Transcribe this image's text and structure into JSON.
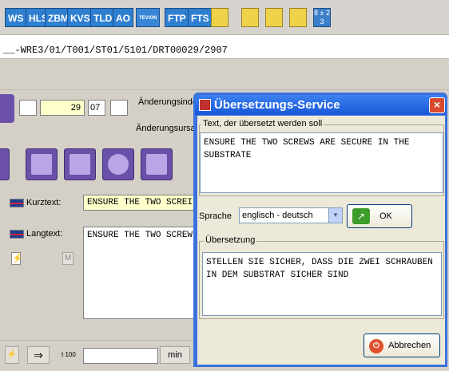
{
  "toolbar": {
    "buttons": [
      "WS",
      "HLS",
      "ZBM",
      "KVS",
      "TLD",
      "AO",
      "TEVION",
      "FTP",
      "FTS"
    ],
    "icons": [
      "copy-icon",
      "calculator-icon",
      "globe-icon",
      "printer-icon"
    ],
    "numpad_glyph": "8 ± 2 3"
  },
  "path": "__-WRE3/01/T001/ST01/5101/DRT00029/2907",
  "form": {
    "field_29": "29",
    "field_07": "07",
    "aenderungsindex_label": "Änderungsinde",
    "aenderungsursache_label": "Änderungsursa",
    "kurztext_label": "Kurztext:",
    "kurztext_value": "ENSURE THE TWO SCREI",
    "langtext_label": "Langtext:",
    "langtext_value": "ENSURE THE TWO SCREW",
    "m_label": "M",
    "time_label": "t 100",
    "min_label": "min"
  },
  "dialog": {
    "title": "Übersetzungs-Service",
    "source_group_label": "Text, der übersetzt werden soll",
    "source_text": "ENSURE THE TWO SCREWS ARE SECURE IN THE SUBSTRATE",
    "language_label": "Sprache",
    "language_value": "englisch - deutsch",
    "ok_label": "OK",
    "translation_group_label": "Übersetzung",
    "translation_text": "STELLEN SIE SICHER, DASS DIE ZWEI SCHRAUBEN IN DEM SUBSTRAT SICHER SIND",
    "cancel_label": "Abbrechen"
  },
  "colors": {
    "title_bar": "#1858d8",
    "dialog_body": "#ece9d8",
    "toolbar_button": "#2f7fd0",
    "yellow_field": "#ffffcc"
  }
}
